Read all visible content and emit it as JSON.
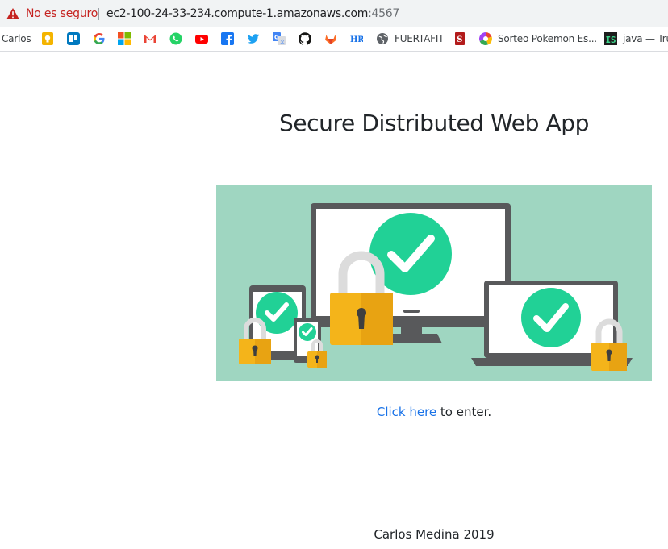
{
  "browser": {
    "security_label": "No es seguro",
    "url_host": "ec2-100-24-33-234.compute-1.amazonaws.com",
    "url_port": ":4567",
    "colors": {
      "insecure": "#c5221f",
      "toolbar_bg": "#f1f3f4"
    }
  },
  "bookmarks": [
    {
      "label": "Carlos",
      "icon": "none"
    },
    {
      "label": "",
      "icon": "keep-icon"
    },
    {
      "label": "",
      "icon": "trello-icon"
    },
    {
      "label": "",
      "icon": "google-icon"
    },
    {
      "label": "",
      "icon": "microsoft-icon"
    },
    {
      "label": "",
      "icon": "gmail-icon"
    },
    {
      "label": "",
      "icon": "whatsapp-icon"
    },
    {
      "label": "",
      "icon": "youtube-icon"
    },
    {
      "label": "",
      "icon": "facebook-icon"
    },
    {
      "label": "",
      "icon": "twitter-icon"
    },
    {
      "label": "",
      "icon": "google-translate-icon"
    },
    {
      "label": "",
      "icon": "github-icon"
    },
    {
      "label": "",
      "icon": "gitlab-icon"
    },
    {
      "label": "",
      "icon": "hr-icon"
    },
    {
      "label": "FUERTAFIT",
      "icon": "globe-icon"
    },
    {
      "label": "",
      "icon": "scrapbook-icon"
    },
    {
      "label": "Sorteo Pokemon Es...",
      "icon": "pokemon-icon"
    },
    {
      "label": "java — Tru",
      "icon": "js-icon"
    }
  ],
  "page": {
    "title": "Secure Distributed Web App",
    "enter_link": "Click here",
    "enter_suffix": " to enter.",
    "footer": "Carlos Medina 2019",
    "hero_image": "secure-devices-illustration",
    "colors": {
      "hero_bg": "#9fd6c1",
      "check_green": "#21d196",
      "lock_gold": "#f4b41a",
      "link": "#1a73e8"
    }
  }
}
